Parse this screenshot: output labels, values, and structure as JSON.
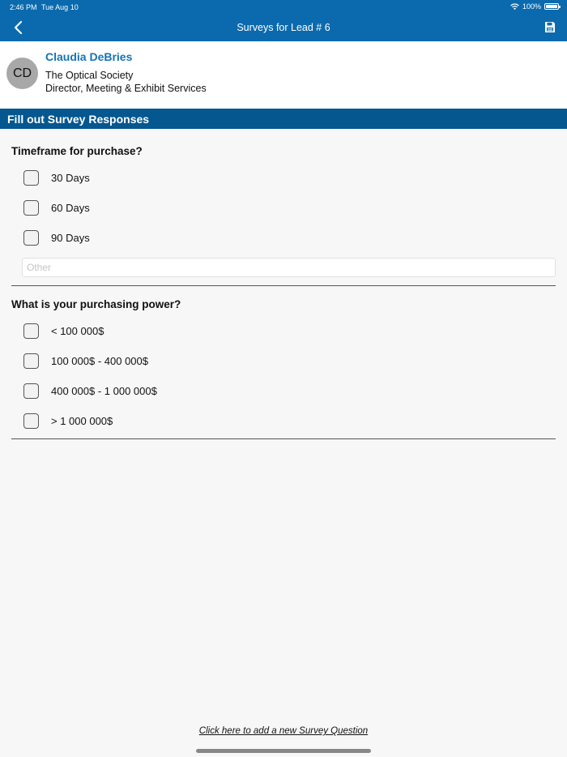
{
  "status_bar": {
    "time": "2:46 PM",
    "date": "Tue Aug 10",
    "battery": "100%",
    "battery_level": 1.0,
    "wifi_icon": "wifi-icon",
    "battery_icon": "battery-icon"
  },
  "nav": {
    "title": "Surveys for Lead # 6",
    "back_icon": "chevron-left-icon",
    "save_icon": "floppy-disk-icon"
  },
  "contact": {
    "initials": "CD",
    "name": "Claudia DeBries",
    "organization": "The Optical Society",
    "title": "Director, Meeting & Exhibit Services"
  },
  "section_title": "Fill out Survey Responses",
  "questions": [
    {
      "text": "Timeframe for purchase?",
      "options": [
        {
          "label": "30 Days",
          "checked": false
        },
        {
          "label": "60 Days",
          "checked": false
        },
        {
          "label": "90 Days",
          "checked": false
        }
      ],
      "other_placeholder": "Other"
    },
    {
      "text": "What is your purchasing power?",
      "options": [
        {
          "label": "< 100 000$",
          "checked": false
        },
        {
          "label": "100 000$ - 400 000$",
          "checked": false
        },
        {
          "label": "400 000$ - 1 000 000$",
          "checked": false
        },
        {
          "label": "> 1 000 000$",
          "checked": false
        }
      ]
    }
  ],
  "add_question_link": "Click here to add a new Survey Question",
  "colors": {
    "nav_bar": "#0a6aad",
    "section_header": "#04578f",
    "contact_name": "#1474b4",
    "background": "#f7f7f7"
  }
}
